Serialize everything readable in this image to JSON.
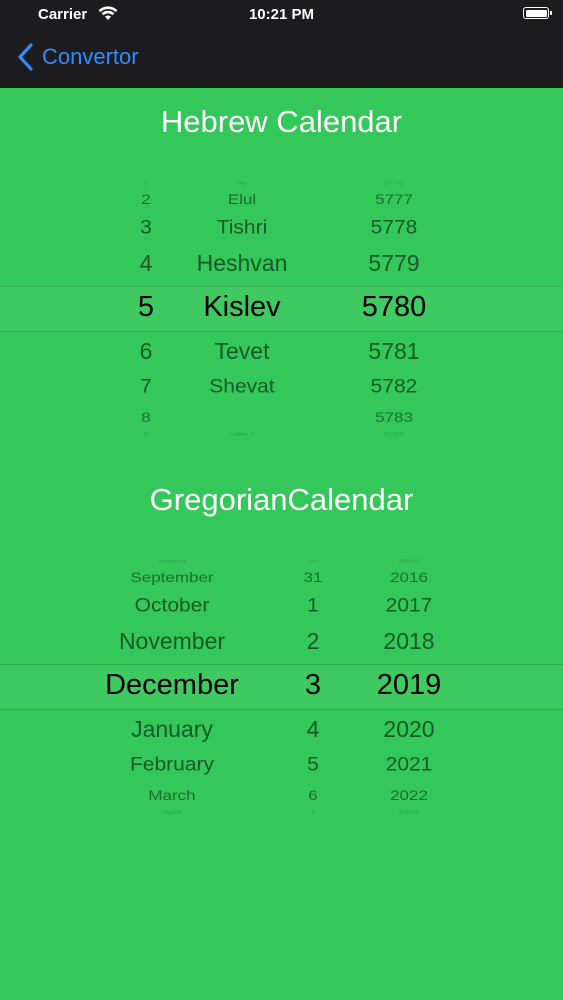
{
  "status_bar": {
    "carrier": "Carrier",
    "time": "10:21 PM"
  },
  "nav": {
    "back_label": "Convertor"
  },
  "hebrew": {
    "title": "Hebrew Calendar",
    "columns": {
      "day": [
        "1",
        "2",
        "3",
        "4",
        "5",
        "6",
        "7",
        "8",
        "9"
      ],
      "month": [
        "Av",
        "Elul",
        "Tishri",
        "Heshvan",
        "Kislev",
        "Tevet",
        "Shevat",
        "",
        "Adar II"
      ],
      "year": [
        "5776",
        "5777",
        "5778",
        "5779",
        "5780",
        "5781",
        "5782",
        "5783",
        "5784"
      ]
    },
    "selected": {
      "day": "5",
      "month": "Kislev",
      "year": "5780"
    }
  },
  "gregorian": {
    "title": "GregorianCalendar",
    "columns": {
      "month": [
        "August",
        "September",
        "October",
        "November",
        "December",
        "January",
        "February",
        "March",
        "April"
      ],
      "day": [
        "30",
        "31",
        "1",
        "2",
        "3",
        "4",
        "5",
        "6",
        "7"
      ],
      "year": [
        "2015",
        "2016",
        "2017",
        "2018",
        "2019",
        "2020",
        "2021",
        "2022",
        "2023"
      ]
    },
    "selected": {
      "month": "December",
      "day": "3",
      "year": "2019"
    }
  },
  "colors": {
    "background": "#34c759",
    "nav_bar": "#1c1c1e",
    "accent": "#2f8cff"
  }
}
